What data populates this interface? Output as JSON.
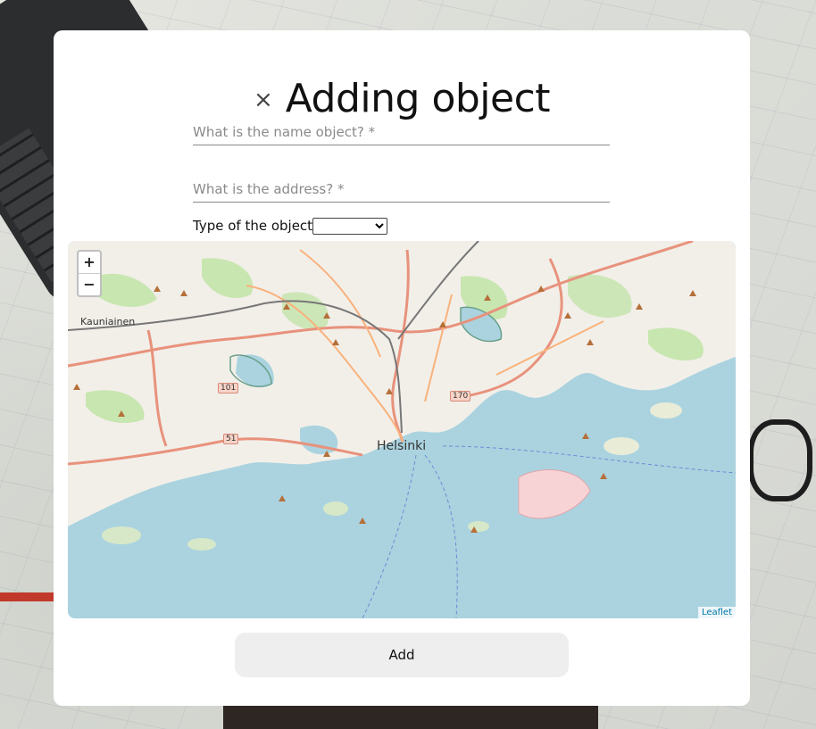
{
  "modal": {
    "close_glyph": "×",
    "title": "Adding object"
  },
  "form": {
    "name_placeholder": "What is the name object? *",
    "address_placeholder": "What is the address? *",
    "type_label": "Type of the object",
    "type_selected": ""
  },
  "map": {
    "zoom_in": "+",
    "zoom_out": "−",
    "attribution": "Leaflet",
    "labels": {
      "city": "Helsinki",
      "kauniainen": "Kauniainen"
    },
    "shields": [
      "101",
      "170",
      "51"
    ],
    "colors": {
      "water": "#aad3df",
      "land": "#f2efe9",
      "park": "#c8e6b0",
      "highway": "#e8927c",
      "primary": "#f9b27c",
      "nature_marker": "#b5703a"
    }
  },
  "actions": {
    "add_label": "Add"
  }
}
